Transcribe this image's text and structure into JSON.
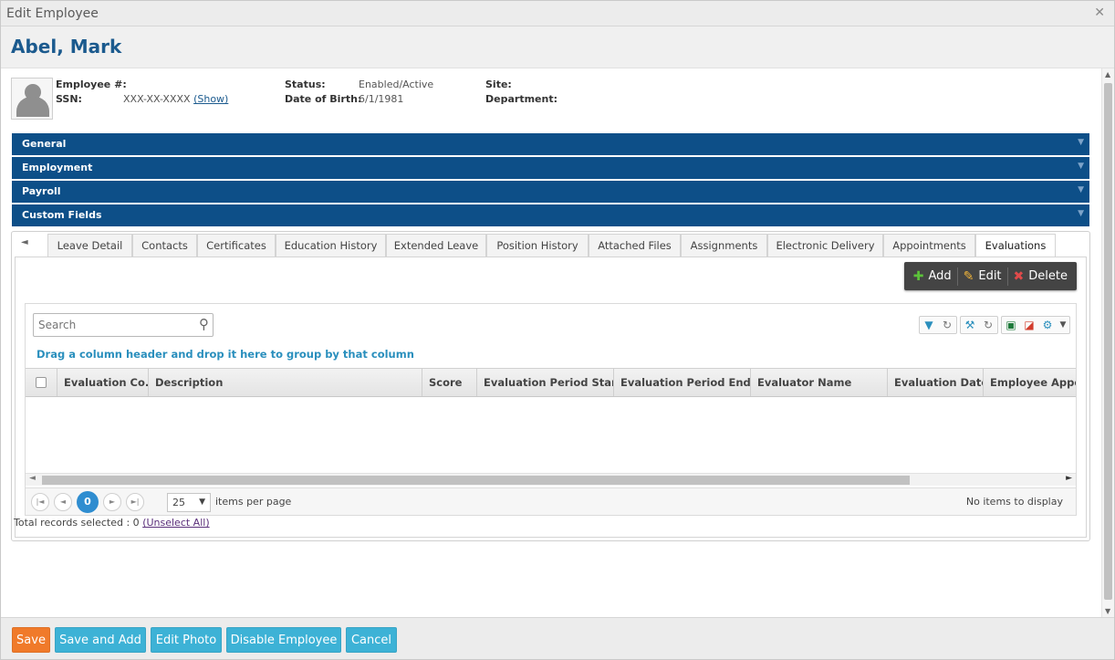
{
  "window": {
    "title": "Edit Employee"
  },
  "employee": {
    "name": "Abel, Mark",
    "fields": {
      "employee_num_label": "Employee #:",
      "employee_num_value": "",
      "ssn_label": "SSN:",
      "ssn_value": "XXX-XX-XXXX",
      "ssn_show": "(Show)",
      "status_label": "Status:",
      "status_value": "Enabled/Active",
      "dob_label": "Date of Birth:",
      "dob_value": "6/1/1981",
      "site_label": "Site:",
      "site_value": "",
      "department_label": "Department:",
      "department_value": ""
    }
  },
  "sections": [
    {
      "label": "General"
    },
    {
      "label": "Employment"
    },
    {
      "label": "Payroll"
    },
    {
      "label": "Custom Fields"
    }
  ],
  "tabs": [
    {
      "label": "Leave Detail"
    },
    {
      "label": "Contacts"
    },
    {
      "label": "Certificates"
    },
    {
      "label": "Education History"
    },
    {
      "label": "Extended Leave"
    },
    {
      "label": "Position History"
    },
    {
      "label": "Attached Files"
    },
    {
      "label": "Assignments"
    },
    {
      "label": "Electronic Delivery"
    },
    {
      "label": "Appointments"
    },
    {
      "label": "Evaluations"
    }
  ],
  "active_tab": "Evaluations",
  "toolbar": {
    "add_label": "Add",
    "edit_label": "Edit",
    "delete_label": "Delete"
  },
  "grid": {
    "search_placeholder": "Search",
    "group_hint": "Drag a column header and drop it here to group by that column",
    "columns": [
      "Evaluation Co...",
      "Description",
      "Score",
      "Evaluation Period Start",
      "Evaluation Period End",
      "Evaluator Name",
      "Evaluation Date",
      "Employee Appoi"
    ],
    "sort_indicator": "▲",
    "rows": [],
    "pager": {
      "current_page": "0",
      "page_size": "25",
      "items_per_page_label": "items per page",
      "no_items_label": "No items to display"
    },
    "icons": [
      "filter-icon",
      "refresh-icon",
      "wrench-icon",
      "refresh-icon",
      "excel-icon",
      "pdf-icon",
      "gear-icon"
    ]
  },
  "selection": {
    "total_label": "Total records selected : 0",
    "unselect_label": "(Unselect All)"
  },
  "footer": {
    "save": "Save",
    "save_and_add": "Save and Add",
    "edit_photo": "Edit Photo",
    "disable_employee": "Disable Employee",
    "cancel": "Cancel"
  },
  "colors": {
    "section_bar": "#0d4f88",
    "title_text": "#1b5a8e",
    "save_button": "#f07a2a",
    "secondary_button": "#3db2d6",
    "pager_current": "#2f8dd0"
  }
}
